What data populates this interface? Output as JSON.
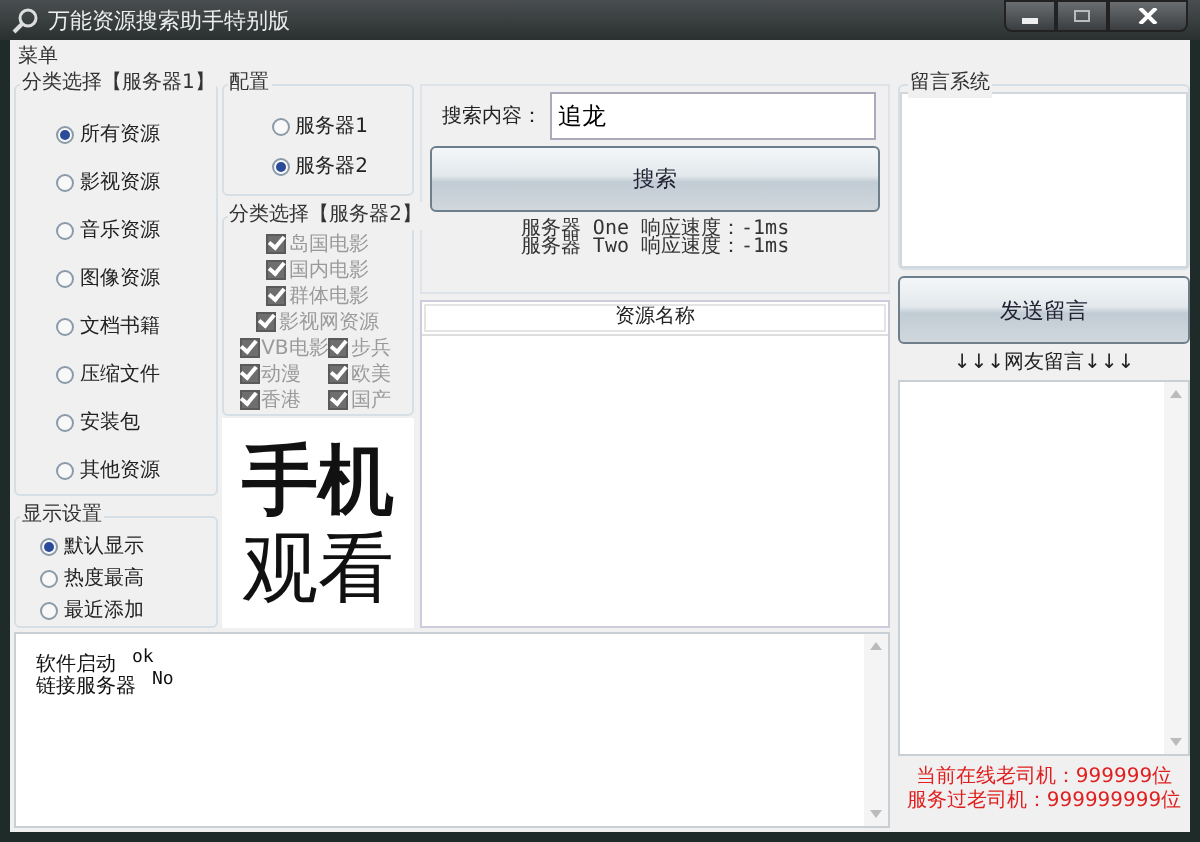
{
  "window": {
    "title": "万能资源搜索助手特别版"
  },
  "menu": [
    "菜单"
  ],
  "category_group": {
    "title": "分类选择【服务器1】",
    "options": [
      {
        "label": "所有资源",
        "selected": true
      },
      {
        "label": "影视资源",
        "selected": false
      },
      {
        "label": "音乐资源",
        "selected": false
      },
      {
        "label": "图像资源",
        "selected": false
      },
      {
        "label": "文档书籍",
        "selected": false
      },
      {
        "label": "压缩文件",
        "selected": false
      },
      {
        "label": "安装包",
        "selected": false
      },
      {
        "label": "其他资源",
        "selected": false
      }
    ]
  },
  "display_group": {
    "title": "显示设置",
    "options": [
      {
        "label": "默认显示",
        "selected": true
      },
      {
        "label": "热度最高",
        "selected": false
      },
      {
        "label": "最近添加",
        "selected": false
      }
    ]
  },
  "config_group": {
    "title": "配置",
    "options": [
      {
        "label": "服务器1",
        "selected": false
      },
      {
        "label": "服务器2",
        "selected": true
      }
    ]
  },
  "category_group_2": {
    "title": "分类选择【服务器2】",
    "checkboxes": [
      {
        "label": "岛国电影",
        "checked": true,
        "disabled": true,
        "kind": "wide"
      },
      {
        "label": "国内电影",
        "checked": true,
        "disabled": true,
        "kind": "wide"
      },
      {
        "label": "群体电影",
        "checked": true,
        "disabled": true,
        "kind": "wide"
      },
      {
        "label": "影视网资源",
        "checked": true,
        "disabled": true,
        "kind": "wide"
      },
      {
        "label": "VB电影",
        "checked": true,
        "disabled": true,
        "kind": "narrow"
      },
      {
        "label": "步兵",
        "checked": true,
        "disabled": true,
        "kind": "narrow"
      },
      {
        "label": "动漫",
        "checked": true,
        "disabled": true,
        "kind": "narrow"
      },
      {
        "label": "欧美",
        "checked": true,
        "disabled": true,
        "kind": "narrow"
      },
      {
        "label": "香港",
        "checked": true,
        "disabled": true,
        "kind": "narrow"
      },
      {
        "label": "国产",
        "checked": true,
        "disabled": true,
        "kind": "narrow"
      }
    ]
  },
  "promo": {
    "lines": [
      "手机",
      "观看"
    ]
  },
  "search": {
    "label": "搜索内容：",
    "value": "追龙",
    "button": "搜索",
    "status_lines": [
      "服务器 One 响应速度：-1ms",
      "服务器 Two 响应速度：-1ms"
    ]
  },
  "results": {
    "columns": [
      "资源名称"
    ]
  },
  "log": {
    "lines": [
      {
        "text": "软件启动",
        "value": "ok"
      },
      {
        "text": "链接服务器",
        "value": "No"
      }
    ]
  },
  "messages": {
    "title": "留言系统",
    "send_button": "发送留言",
    "board_title": "↓↓↓网友留言↓↓↓",
    "stats": [
      "当前在线老司机：999999位",
      "服务过老司机：999999999位"
    ]
  }
}
